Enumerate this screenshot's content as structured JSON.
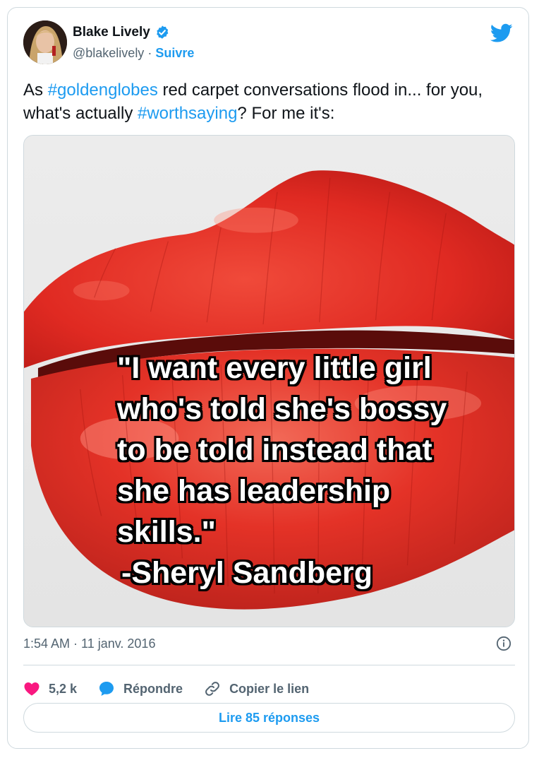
{
  "author": {
    "display_name": "Blake Lively",
    "handle": "@blakelively",
    "separator": " · ",
    "follow_label": "Suivre"
  },
  "tweet": {
    "text_parts": [
      "As ",
      "#goldenglobes",
      " red carpet conversations flood in... for you, what's actually ",
      "#worthsaying",
      "? For me it's:"
    ],
    "timestamp": "1:54 AM · 11 janv. 2016"
  },
  "media": {
    "quote_text": "\"I want every little girl\nwho's told she's bossy\nto be told instead that\nshe has leadership\nskills.\"",
    "quote_author": "-Sheryl Sandberg"
  },
  "actions": {
    "likes_count": "5,2 k",
    "reply_label": "Répondre",
    "copy_link_label": "Copier le lien"
  },
  "footer": {
    "read_replies_label": "Lire 85 réponses"
  },
  "colors": {
    "accent": "#1d9bf0",
    "like": "#f91880",
    "text": "#0f1419",
    "muted": "#536471"
  }
}
